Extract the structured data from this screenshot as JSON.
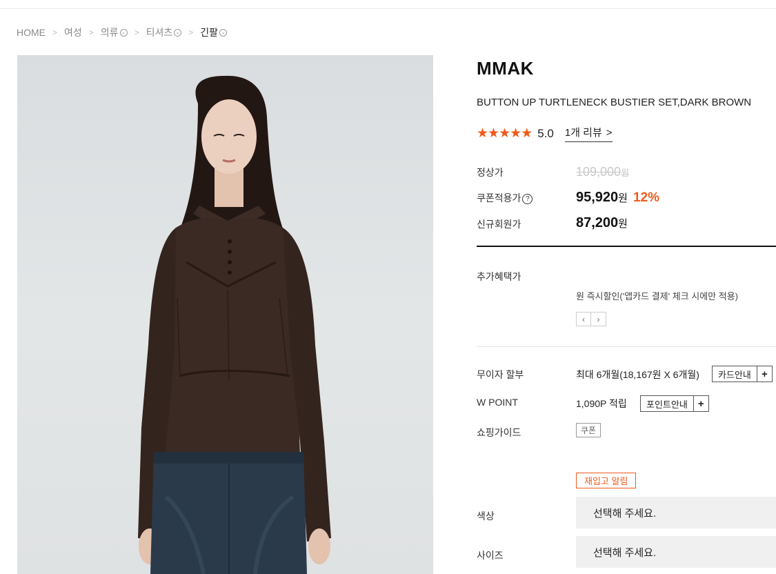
{
  "breadcrumb": {
    "items": [
      {
        "label": "HOME",
        "has_dropdown": false
      },
      {
        "label": "여성",
        "has_dropdown": false
      },
      {
        "label": "의류",
        "has_dropdown": true
      },
      {
        "label": "티셔츠",
        "has_dropdown": true
      },
      {
        "label": "긴팔",
        "has_dropdown": true
      }
    ],
    "separator": ">",
    "dropdown_glyph": "⌄"
  },
  "product": {
    "brand": "MMAK",
    "name": "BUTTON UP TURTLENECK BUSTIER SET,DARK BROWN",
    "rating": {
      "stars_filled": 5,
      "stars_total": 5,
      "star_glyph": "★",
      "score": "5.0",
      "reviews_label": "1개 리뷰",
      "reviews_arrow": ">"
    },
    "image": {
      "icon": "product-photo-model-dark-brown-top"
    }
  },
  "pricing": {
    "regular_label": "정상가",
    "regular_price": "109,000",
    "currency": "원",
    "coupon_label": "쿠폰적용가",
    "coupon_help_glyph": "?",
    "coupon_price": "95,920",
    "discount": "12%",
    "member_label": "신규회원가",
    "member_price": "87,200"
  },
  "benefits": {
    "label": "추가혜택가",
    "text": "원 즉시할인('앱카드 결제' 체크 시에만 적용)",
    "prev_glyph": "‹",
    "next_glyph": "›"
  },
  "installment": {
    "label": "무이자 할부",
    "text": "최대 6개월(18,167원 X 6개월)",
    "button": "카드안내",
    "plus": "+"
  },
  "points": {
    "label": "W POINT",
    "text": "1,090P 적립",
    "button": "포인트안내",
    "plus": "+"
  },
  "guide": {
    "label": "쇼핑가이드",
    "coupon_button": "쿠폰"
  },
  "restock": {
    "button": "재입고 알림"
  },
  "options": {
    "color_label": "색상",
    "color_placeholder": "선택해 주세요.",
    "size_label": "사이즈",
    "size_placeholder": "선택해 주세요."
  },
  "colors": {
    "accent": "#f05a1a",
    "garment": "#3a2a23",
    "denim": "#2b3a4a"
  }
}
